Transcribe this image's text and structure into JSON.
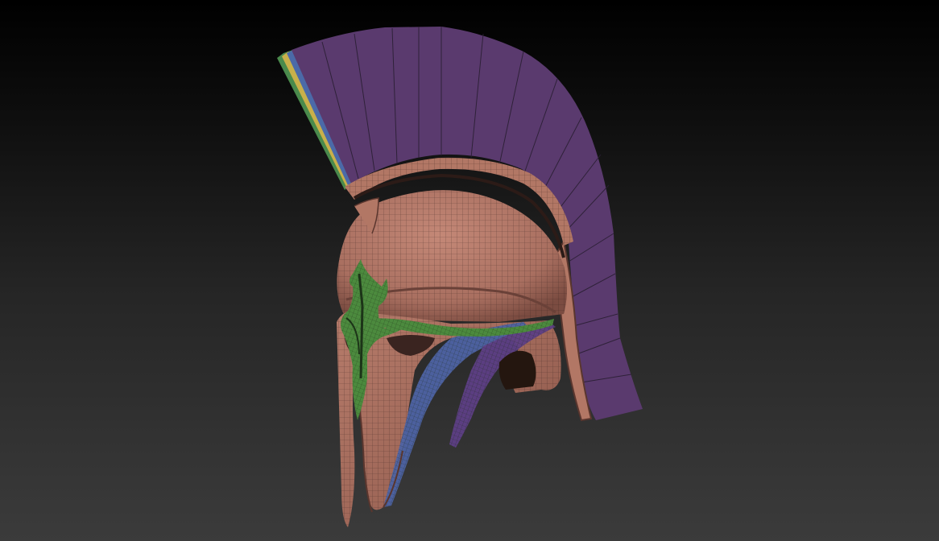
{
  "viewport": {
    "model": "corinthian-helmet-polypaint-wireframe",
    "background": "dark-vertical-gradient"
  },
  "colors": {
    "background_top": "#000000",
    "background_bottom": "#3b3b3b",
    "helmet_skin": "#b27765",
    "helmet_shadow": "#6a4138",
    "crest": "#5a3a6e",
    "crest_edge_yellow": "#c9b04a",
    "crest_edge_green": "#4a8a4c",
    "crest_edge_blue": "#4b6aa8",
    "nose_guard_band": "#4c8a3e",
    "cheek_stripe_blue": "#4e63a4",
    "cheek_stripe_purple": "#5e3f86",
    "wire_line": "#2a1a18"
  }
}
